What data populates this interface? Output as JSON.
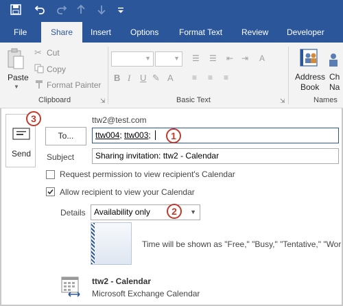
{
  "qat": {
    "icons": [
      "save-icon",
      "undo-icon",
      "redo-icon",
      "up-arrow-icon",
      "down-arrow-icon",
      "customize-icon"
    ]
  },
  "tabs": [
    "File",
    "Share",
    "Insert",
    "Options",
    "Format Text",
    "Review",
    "Developer"
  ],
  "ribbon": {
    "paste": "Paste",
    "cut": "Cut",
    "copy": "Copy",
    "format_painter": "Format Painter",
    "clipboard_group": "Clipboard",
    "basic_text_group": "Basic Text",
    "address_book_line1": "Address",
    "address_book_line2": "Book",
    "check_names_line1": "Ch",
    "check_names_line2": "Na",
    "names_group": "Names"
  },
  "compose": {
    "send_label": "Send",
    "from": "ttw2@test.com",
    "to_button": "To...",
    "to_value_1": "ttw004",
    "to_value_2": "ttw003",
    "subject_label": "Subject",
    "subject_value": "Sharing invitation: ttw2 - Calendar",
    "request_permission": "Request permission to view recipient's Calendar",
    "allow_view": "Allow recipient to view your Calendar",
    "details_label": "Details",
    "details_value": "Availability only",
    "details_description": "Time will be shown as \"Free,\" \"Busy,\" \"Tentative,\" \"Worki",
    "calendar_name": "ttw2 - Calendar",
    "calendar_source": "Microsoft Exchange Calendar"
  },
  "callouts": {
    "one": "1",
    "two": "2",
    "three": "3"
  },
  "colors": {
    "accent": "#2b579a",
    "callout": "#c0392b"
  }
}
